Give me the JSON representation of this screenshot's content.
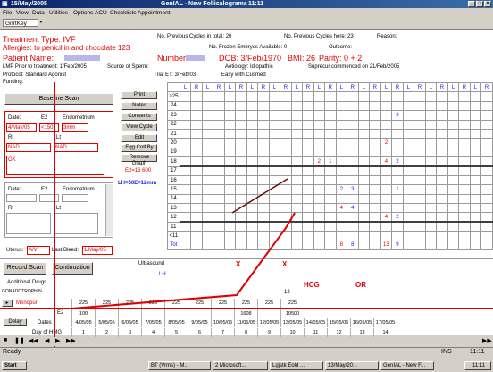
{
  "window": {
    "title": "15/May/2005",
    "app_title": "GenIAL - New Follicalograms",
    "time": "11:11"
  },
  "menu": [
    "File",
    "View",
    "Data",
    "Utilities",
    "Options",
    "ACU",
    "Checklists",
    "Appointment"
  ],
  "toolbar": {
    "combo_value": "GnrtKey"
  },
  "header": {
    "treatment_type": "Treatment Type: IVF",
    "allergies": "Allergies: to penicillin and chocolate 123",
    "prev_cycles_total": "No. Previous Cycles in total: 20",
    "prev_cycles_here": "No. Previous Cycles here: 23",
    "reason_label": "Reason:",
    "frozen_embryos": "No. Frozen Embryos Available: 0",
    "outcome_label": "Outcome:",
    "patient_name_label": "Patient Name:",
    "number_label": "Number:",
    "dob": "DOB: 3/Feb/1970",
    "bmi": "BMI: 26",
    "parity": "Parity: 0 + 2",
    "lmp": "LMP Prior to treatment: 1/Feb/2005",
    "source_of_sperm": "Source of Sperm:",
    "aetiology": "Aetiology: Idiopathic",
    "suprecur": "Suprecur commenced on 21/Feb/2005",
    "protocol": "Protocol: Standard Agonist",
    "trial_et": "Trial ET: 3/Feb/03",
    "easy": "Easy with Cusmed",
    "funding": "Funding:"
  },
  "left_panel": {
    "baseline_scan": "Baseline Scan",
    "date_label": "Date:",
    "e2_label": "E2",
    "endometrium_label": "Endometrium",
    "date_value": "4/May/05",
    "e2_value": "<150",
    "endo_value": "3mm",
    "rt_label": "Rt",
    "lt_label": "Lt",
    "rt_value": "NAD",
    "lt_value": "NAD",
    "comment": "OK",
    "date2_label": "Date:",
    "e2b_label": "E2",
    "endometrium2_label": "Endometrium",
    "rt2_label": "Rt",
    "lt2_label": "Lt",
    "uterus_label": "Uterus:",
    "uterus_value": "A/V",
    "last_bleed_label": "Last Bleed:",
    "last_bleed_value": "1/May/05",
    "record_scan": "Record Scan",
    "continuation": "Continuation"
  },
  "side_buttons": [
    "Print",
    "Notes",
    "Consents",
    "View Cycle",
    "Edit",
    "Egg Coll By",
    "Remove Graph"
  ],
  "annotations": {
    "e2_line": "E2=16 600",
    "lh_line": "LH=50E=12mm"
  },
  "grid": {
    "rows": [
      ">25",
      "24",
      "23",
      "22",
      "21",
      "20",
      "19",
      "18",
      "17",
      "16",
      "15",
      "14",
      "13",
      "12",
      "11",
      "<11",
      "Tot"
    ],
    "day_columns": 14,
    "cells": [
      {
        "row": "23",
        "col": 10,
        "side": "R",
        "value": "3",
        "color": "#1a1ae0"
      },
      {
        "row": "20",
        "col": 10,
        "side": "L",
        "value": "2",
        "color": "#e00000"
      },
      {
        "row": "18",
        "col": 7,
        "side": "L",
        "value": "2",
        "color": "#e00000"
      },
      {
        "row": "18",
        "col": 7,
        "side": "R",
        "value": "1",
        "color": "#1a1ae0"
      },
      {
        "row": "18",
        "col": 10,
        "side": "L",
        "value": "4",
        "color": "#e00000"
      },
      {
        "row": "18",
        "col": 10,
        "side": "R",
        "value": "2",
        "color": "#1a1ae0"
      },
      {
        "row": "15",
        "col": 8,
        "side": "L",
        "value": "2",
        "color": "#1a1ae0"
      },
      {
        "row": "15",
        "col": 8,
        "side": "R",
        "value": "3",
        "color": "#1a1ae0"
      },
      {
        "row": "15",
        "col": 10,
        "side": "R",
        "value": "1",
        "color": "#1a1ae0"
      },
      {
        "row": "13",
        "col": 8,
        "side": "L",
        "value": "4",
        "color": "#e00000"
      },
      {
        "row": "13",
        "col": 8,
        "side": "R",
        "value": "4",
        "color": "#1a1ae0"
      },
      {
        "row": "12",
        "col": 10,
        "side": "L",
        "value": "4",
        "color": "#e00000"
      },
      {
        "row": "12",
        "col": 10,
        "side": "R",
        "value": "2",
        "color": "#1a1ae0"
      },
      {
        "row": "Tot",
        "col": 8,
        "side": "L",
        "value": "8",
        "color": "#e00000"
      },
      {
        "row": "Tot",
        "col": 8,
        "side": "R",
        "value": "8",
        "color": "#1a1ae0"
      },
      {
        "row": "Tot",
        "col": 10,
        "side": "L",
        "value": "13",
        "color": "#e00000"
      },
      {
        "row": "Tot",
        "col": 10,
        "side": "R",
        "value": "9",
        "color": "#1a1ae0"
      }
    ]
  },
  "bottom": {
    "ultrasound_label": "Ultrasound",
    "x_marks": [
      "X",
      "X"
    ],
    "lh_label": "LH",
    "additional_drugs": "Additional Drugs",
    "gonadotropin_label": "GONADOTROPHIN",
    "hcg": "HCG",
    "or": "OR",
    "val_12": "12",
    "menopur_label": "Menopur",
    "menopur_values": [
      "225",
      "225",
      "225",
      "225",
      "225",
      "225",
      "225",
      "225",
      "225",
      "225"
    ],
    "e2_label": "E2",
    "e2_values": [
      "100",
      "",
      "",
      "",
      "",
      "",
      "",
      "1608",
      "",
      "10500"
    ],
    "delay_button": "Delay",
    "dates_label": "Dates",
    "dates": [
      "4/05/05",
      "5/05/05",
      "6/05/05",
      "7/05/05",
      "8/05/05",
      "9/05/05",
      "10/05/05",
      "11/05/05",
      "12/05/05",
      "13/05/05",
      "14/05/05",
      "15/05/05",
      "16/05/05",
      "17/05/05"
    ],
    "day_hmg_label": "Day of HMG",
    "day_hmg_values": [
      "1",
      "2",
      "3",
      "4",
      "5",
      "6",
      "7",
      "8",
      "9",
      "10",
      "11",
      "12",
      "13",
      "14"
    ]
  },
  "status": {
    "text": "Ready",
    "ins": "INS",
    "time": "11:11"
  },
  "taskbar": {
    "start": "Start",
    "tasks": [
      "BT (Vrms) - M...",
      "2 Microsoft...",
      "Lgjstk Eold ...",
      "13/May/20...",
      "GenIAL - New F..."
    ],
    "clock": "11:11"
  },
  "colors": {
    "accent_red": "#e00000",
    "accent_blue": "#1a1ae0",
    "titlebar": "#0a246a"
  }
}
